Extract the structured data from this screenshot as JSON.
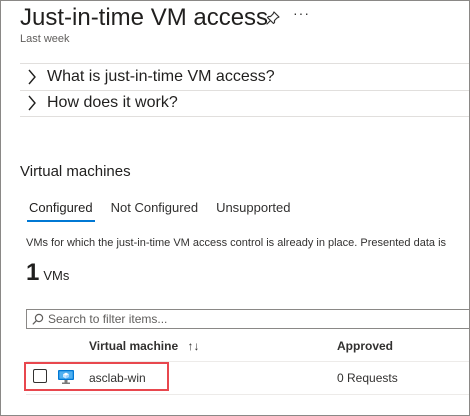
{
  "header": {
    "title": "Just-in-time VM access",
    "subtitle": "Last week"
  },
  "accordions": [
    {
      "label": "What is just-in-time VM access?"
    },
    {
      "label": "How does it work?"
    }
  ],
  "vm_section": {
    "heading": "Virtual machines",
    "tabs": [
      {
        "label": "Configured",
        "active": true
      },
      {
        "label": "Not Configured",
        "active": false
      },
      {
        "label": "Unsupported",
        "active": false
      }
    ],
    "description": "VMs for which the just-in-time VM access control is already in place. Presented data is",
    "count": "1",
    "count_unit": "VMs",
    "search": {
      "placeholder": "Search to filter items..."
    },
    "columns": {
      "vm": "Virtual machine",
      "sort_glyph": "↑↓",
      "approved": "Approved"
    },
    "rows": [
      {
        "name": "asclab-win",
        "approved": "0 Requests"
      }
    ]
  },
  "colors": {
    "accent": "#0078d4",
    "highlight": "#e8474e"
  }
}
